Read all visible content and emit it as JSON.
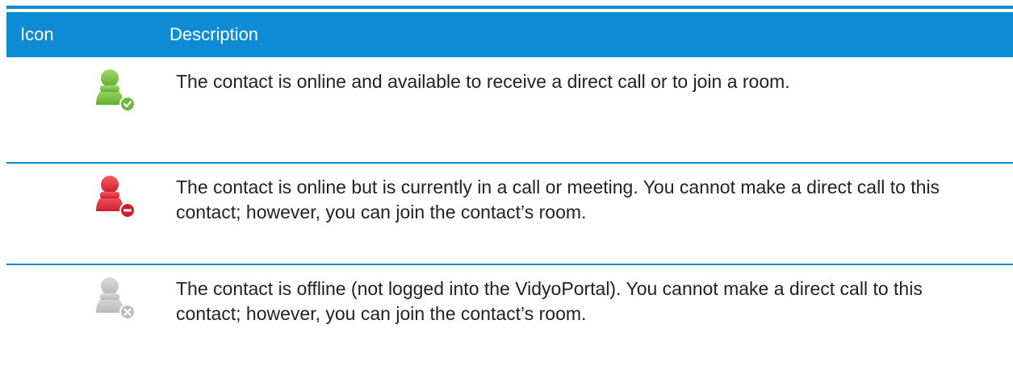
{
  "header": {
    "icon_label": "Icon",
    "description_label": "Description"
  },
  "rows": [
    {
      "icon": "user-available-icon",
      "status_color": "#7dc142",
      "badge_color": "#6fb83b",
      "description": "The contact is online and available to receive a direct call or to join a room."
    },
    {
      "icon": "user-busy-icon",
      "status_color": "#e8313d",
      "badge_color": "#cc1f2c",
      "description": "The contact is online but is currently in a call or meeting. You cannot make a direct call to this contact; however, you can join the contact’s room."
    },
    {
      "icon": "user-offline-icon",
      "status_color": "#c9c9c9",
      "badge_color": "#bdbdbd",
      "description": "The contact is offline (not logged into the VidyoPortal). You cannot make a direct call to this contact; however, you can join the contact’s room."
    }
  ],
  "colors": {
    "accent": "#0d8bd4",
    "text": "#222222"
  }
}
